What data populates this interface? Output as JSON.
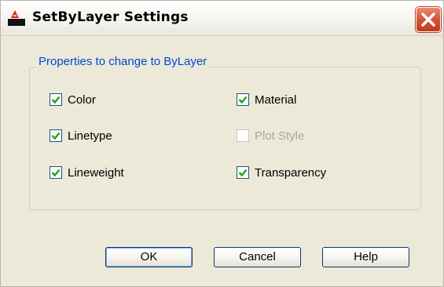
{
  "window": {
    "title": "SetByLayer Settings",
    "app_icon": "autocad-icon",
    "close_icon": "close-icon",
    "close_color": "#d9583a"
  },
  "group": {
    "label": "Properties to change to ByLayer"
  },
  "options": {
    "color": {
      "label": "Color",
      "checked": true,
      "enabled": true
    },
    "material": {
      "label": "Material",
      "checked": true,
      "enabled": true
    },
    "linetype": {
      "label": "Linetype",
      "checked": true,
      "enabled": true
    },
    "plot_style": {
      "label": "Plot Style",
      "checked": false,
      "enabled": false
    },
    "lineweight": {
      "label": "Lineweight",
      "checked": true,
      "enabled": true
    },
    "transparency": {
      "label": "Transparency",
      "checked": true,
      "enabled": true
    }
  },
  "buttons": {
    "ok": "OK",
    "cancel": "Cancel",
    "help": "Help"
  },
  "colors": {
    "accent": "#0046d5",
    "check": "#21a121"
  }
}
